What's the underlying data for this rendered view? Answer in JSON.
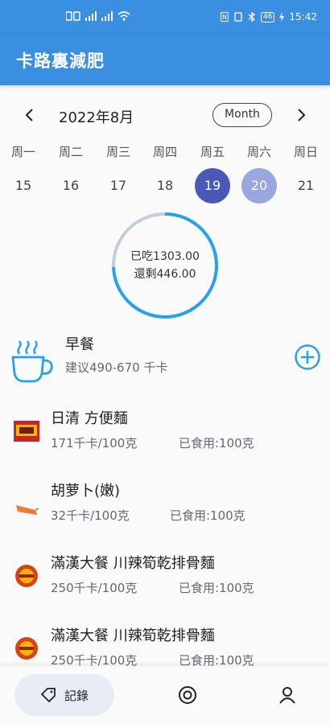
{
  "status_bar": {
    "time": "15:42",
    "battery": "46"
  },
  "app": {
    "title": "卡路裏減肥"
  },
  "calendar": {
    "month_label": "2022年8月",
    "format_button": "Month",
    "prev_icon": "chevron-left-icon",
    "next_icon": "chevron-right-icon",
    "weekdays": [
      "周一",
      "周二",
      "周三",
      "周四",
      "周五",
      "周六",
      "周日"
    ],
    "dates": [
      "15",
      "16",
      "17",
      "18",
      "19",
      "20",
      "21"
    ],
    "selected_date": "19",
    "today_date": "20",
    "selected_color": "#4a58b7",
    "today_color": "#9aa6de"
  },
  "summary": {
    "eaten": "已吃1303.00",
    "remaining": "還剩446.00",
    "ring_fraction": 0.745,
    "ring_color": "#29a3e8",
    "ring_bg_color": "#c3cfd6"
  },
  "meal": {
    "title": "早餐",
    "suggest": "建议490-670 千卡",
    "icon": "coffee-cup-icon",
    "add_icon": "add-circle-icon"
  },
  "foods": [
    {
      "name": "日清 方便麵",
      "kcal": "171千卡/100克",
      "eaten": "已食用:100克"
    },
    {
      "name": "胡萝卜(嫩)",
      "kcal": "32千卡/100克",
      "eaten": "已食用:100克"
    },
    {
      "name": "滿漢大餐 川辣筍乾排骨麵",
      "kcal": "250千卡/100克",
      "eaten": "已食用:100克"
    },
    {
      "name": "滿漢大餐 川辣筍乾排骨麵",
      "kcal": "250千卡/100克",
      "eaten": "已食用:100克"
    }
  ],
  "nav": {
    "record_label": "記錄",
    "record_icon": "tag-icon",
    "stats_icon": "target-icon",
    "profile_icon": "person-icon"
  },
  "colors": {
    "primary": "#3b8fe0",
    "accent": "#29a3e8"
  }
}
